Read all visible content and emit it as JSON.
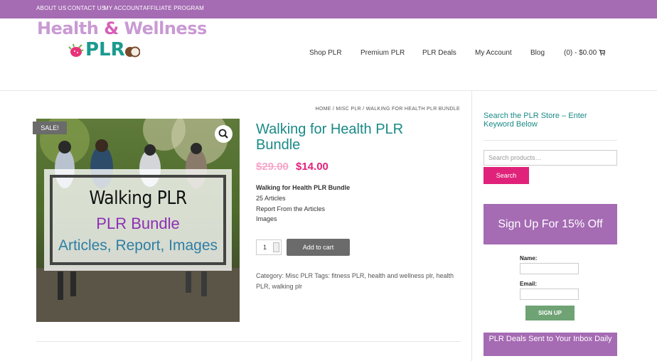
{
  "colors": {
    "purple": "#a56bb3",
    "teal": "#1a8a86",
    "pink": "#e0227a",
    "green": "#6fa374",
    "gray_button": "#6b6b6b"
  },
  "topbar": {
    "links": [
      "ABOUT US",
      "CONTACT US",
      "MY ACCOUNT",
      "AFFILIATE PROGRAM"
    ]
  },
  "logo": {
    "line1": "Health",
    "amp": "&",
    "line1b": "Wellness",
    "line2": "PLR"
  },
  "nav": {
    "items": [
      "Shop PLR",
      "Premium PLR",
      "PLR Deals",
      "My Account",
      "Blog"
    ],
    "cart": "(0) - $0.00",
    "cart_icon": "cart-icon"
  },
  "breadcrumb": "HOME / MISC PLR / WALKING FOR HEALTH PLR BUNDLE",
  "product": {
    "badge": "SALE!",
    "image_line1": "Walking PLR",
    "image_line2": "PLR Bundle",
    "image_line3": "Articles, Report, Images",
    "title": "Walking for Health PLR Bundle",
    "price_old": "$29.00",
    "price_new": "$14.00",
    "desc_title": "Walking for Health PLR Bundle",
    "desc_lines": [
      "25 Articles",
      "Report From the Articles",
      "Images"
    ],
    "quantity": "1",
    "add_to_cart": "Add to cart",
    "meta": "Category: Misc PLR Tags: fitness PLR, health and wellness plr, health PLR, walking plr"
  },
  "sidebar": {
    "search_title": "Search the PLR Store – Enter Keyword Below",
    "search_placeholder": "Search products…",
    "search_button": "Search",
    "signup_banner": "Sign Up For 15% Off",
    "name_label": "Name:",
    "email_label": "Email:",
    "signup_button": "SIGN UP",
    "deals_banner": "PLR Deals Sent to Your Inbox Daily"
  }
}
